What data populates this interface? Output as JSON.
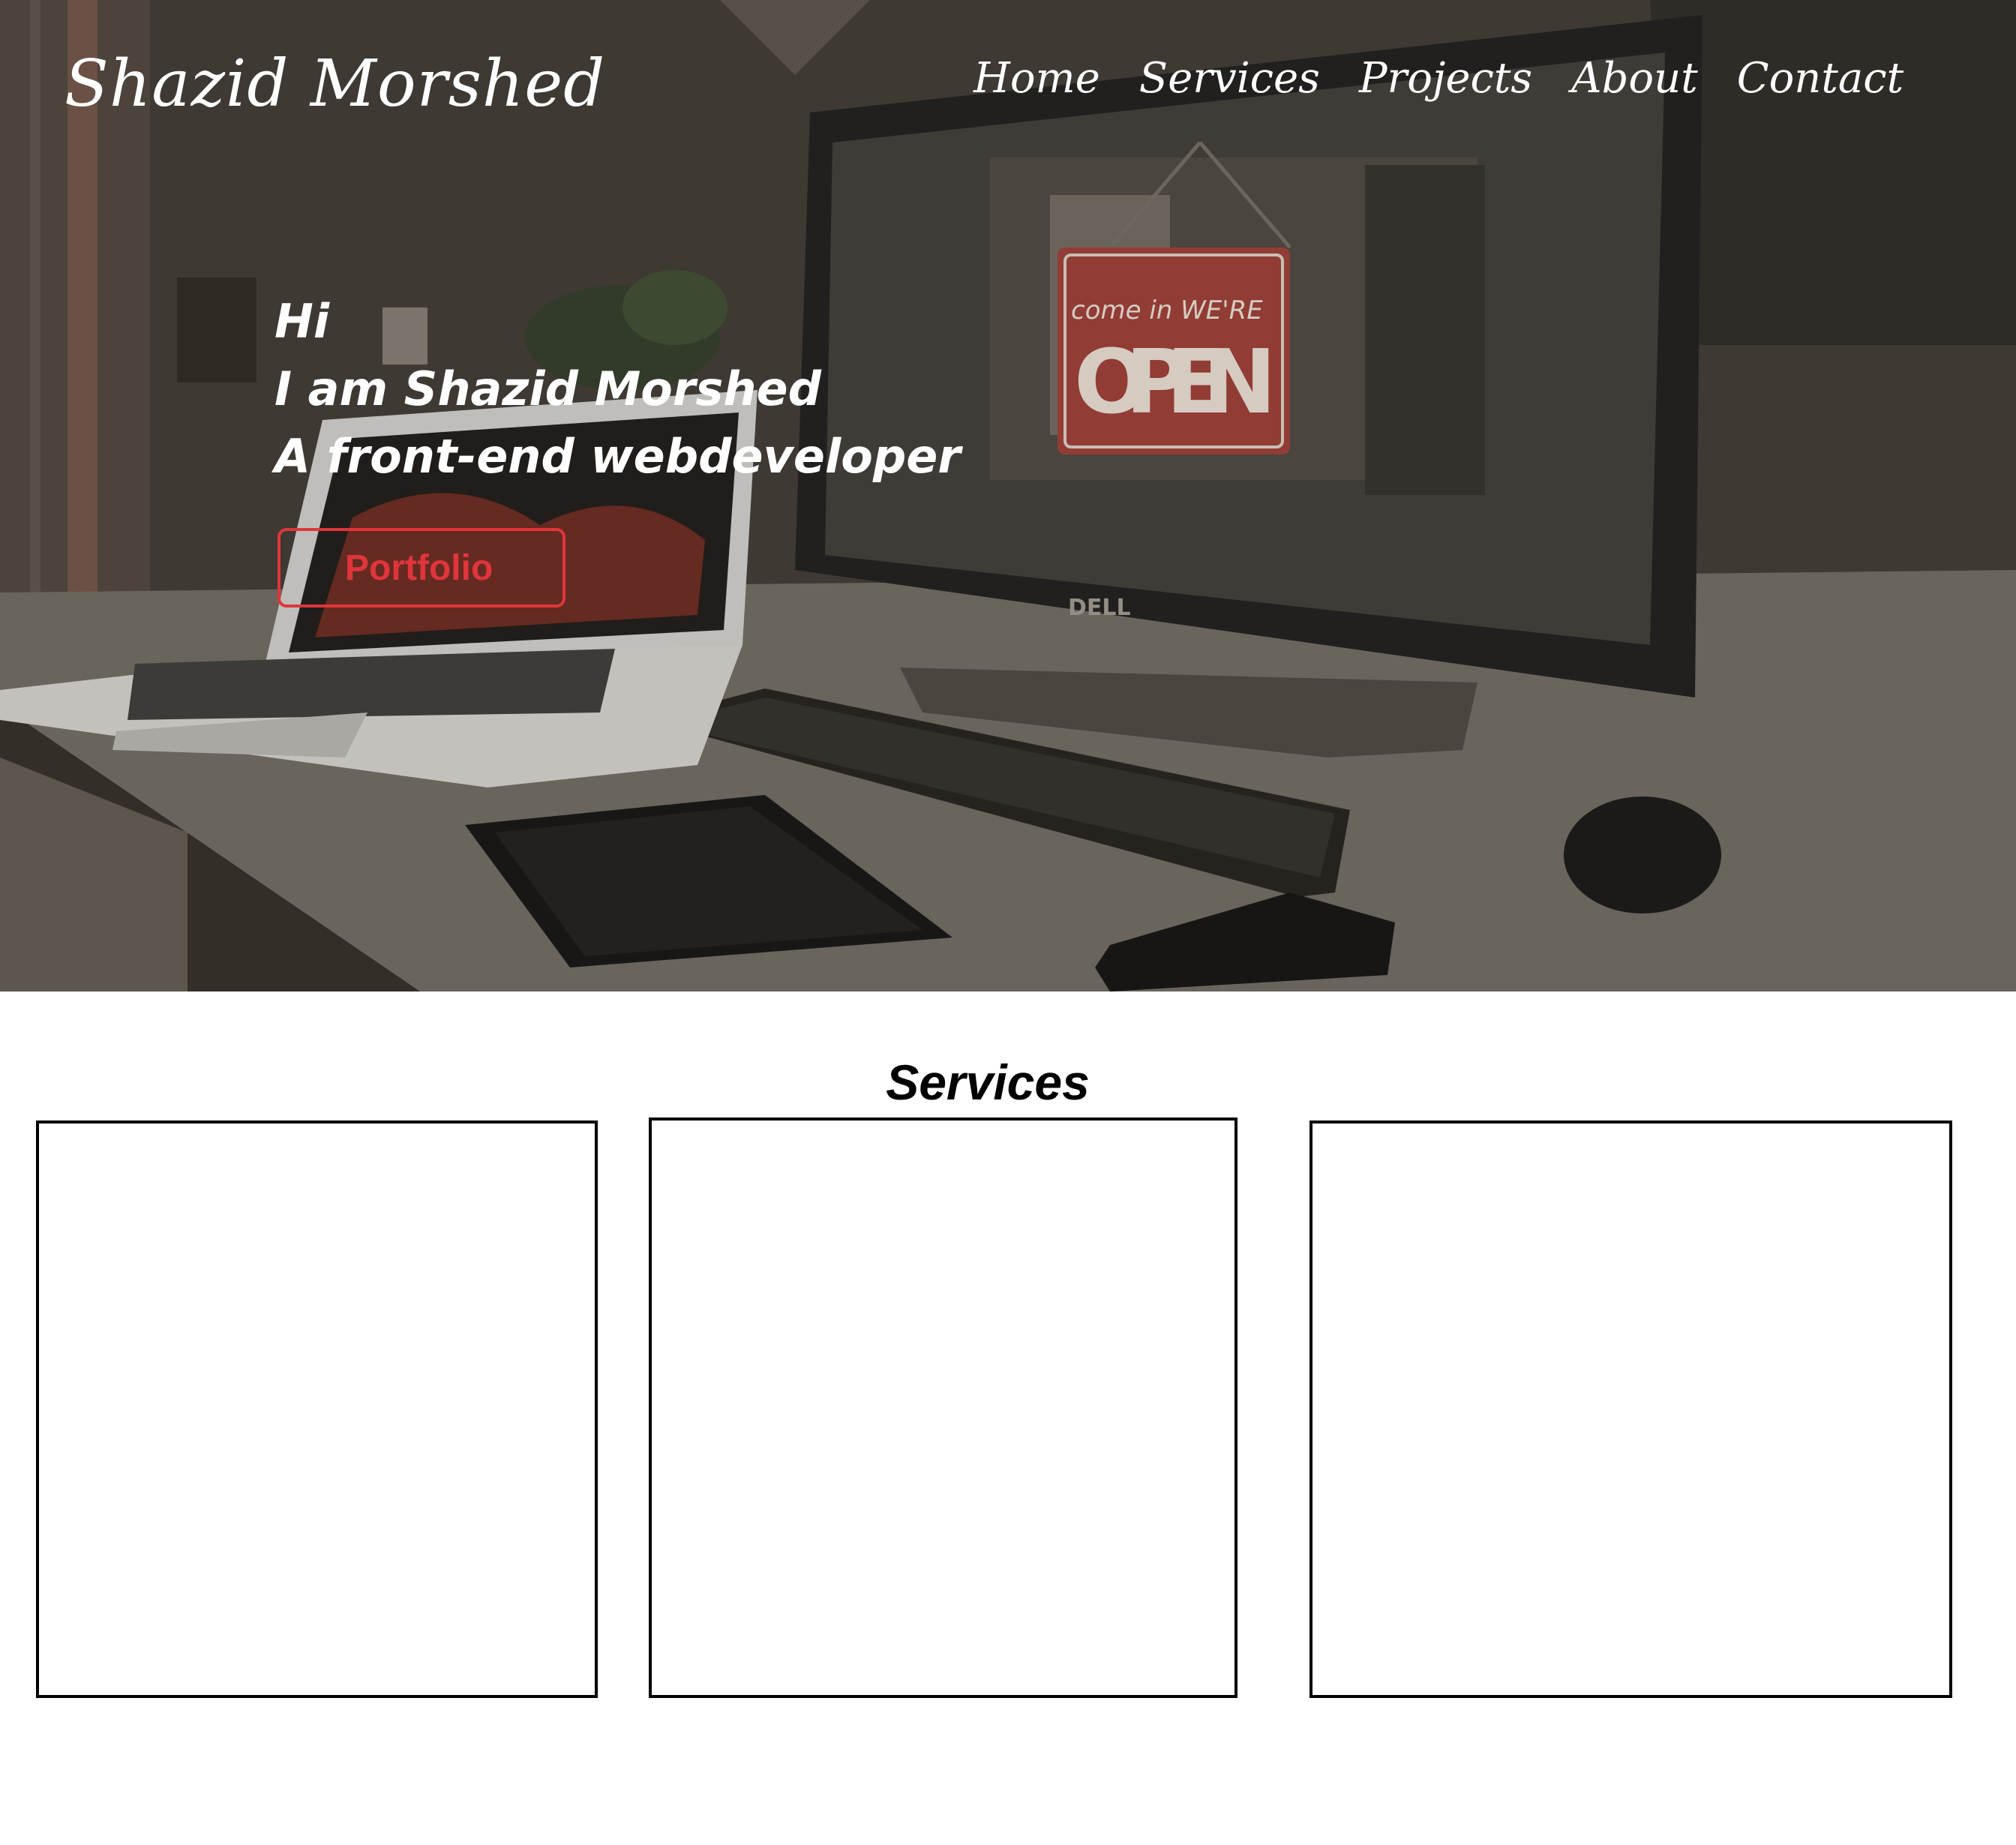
{
  "header": {
    "brand": "Shazid Morshed",
    "nav": [
      "Home",
      "Services",
      "Projects",
      "About",
      "Contact"
    ]
  },
  "hero": {
    "greeting": "Hi",
    "name_line": "I am Shazid Morshed",
    "role_line": "A front-end webdeveloper",
    "cta_label": "Portfolio",
    "background": {
      "monitor_brand": "DELL",
      "sign_top": "come in WE'RE",
      "sign_main": "OPEN"
    }
  },
  "services": {
    "title": "Services",
    "cards": [
      {},
      {},
      {}
    ]
  },
  "colors": {
    "accent": "#e0353b",
    "hero_overlay": "#3a3631",
    "text_light": "#ffffff",
    "text_dark": "#000000"
  }
}
